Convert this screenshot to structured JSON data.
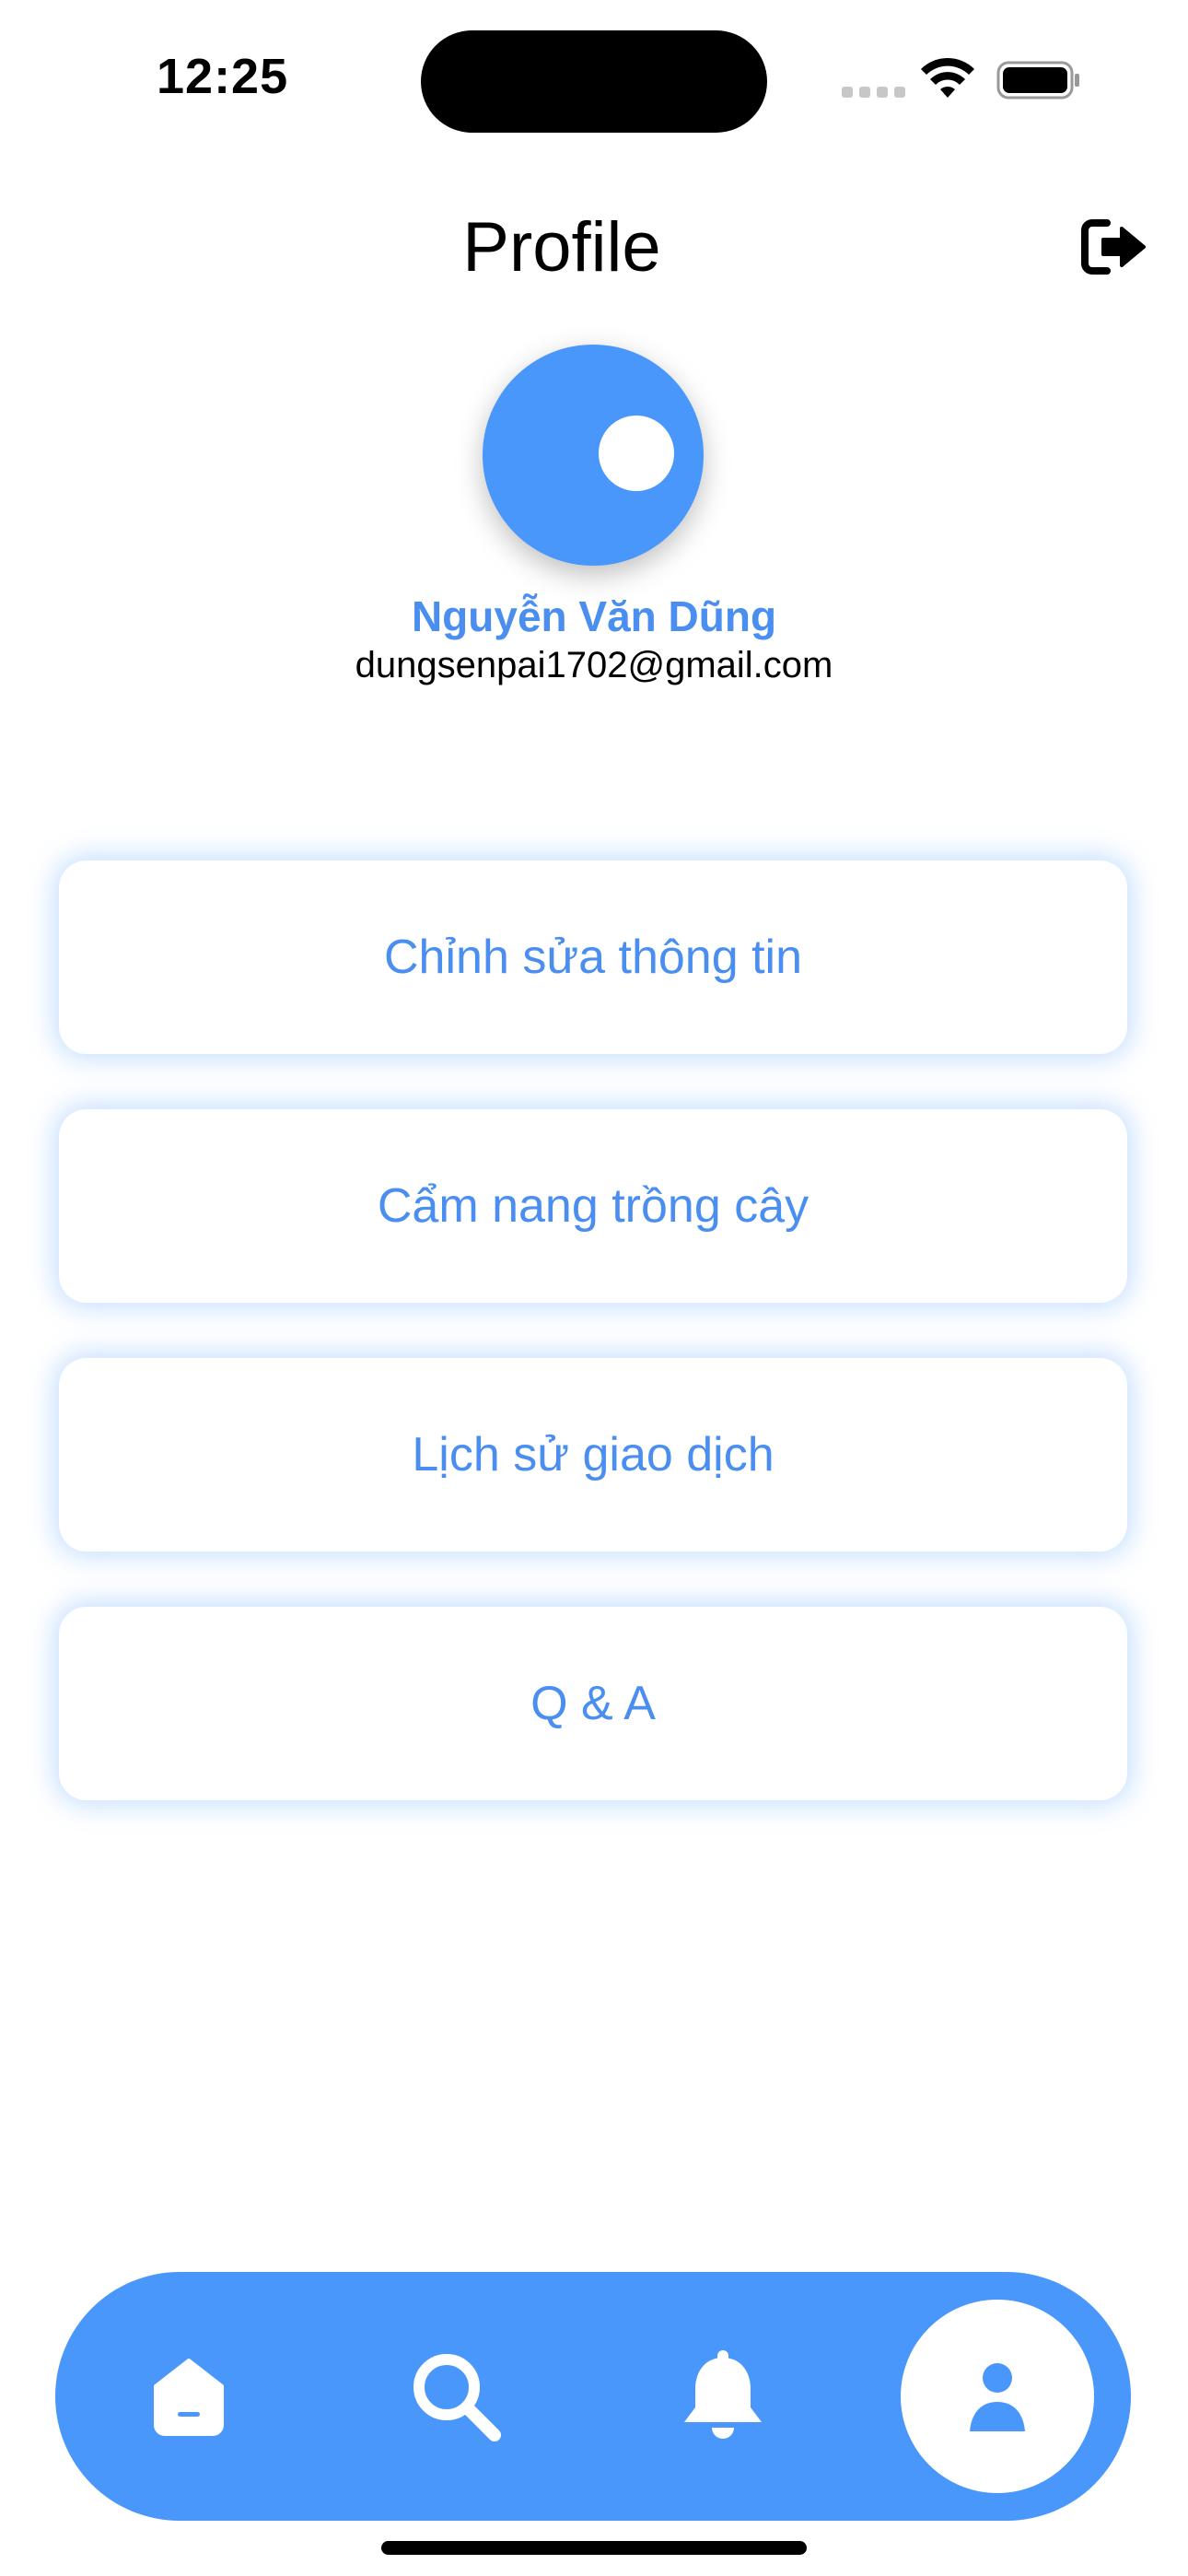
{
  "status_bar": {
    "time": "12:25",
    "icons": [
      "cellular-signal-icon",
      "wifi-icon",
      "battery-icon"
    ]
  },
  "header": {
    "title": "Profile",
    "logout_icon": "logout-icon"
  },
  "profile": {
    "name": "Nguyễn Văn Dũng",
    "email": "dungsenpai1702@gmail.com"
  },
  "menu": {
    "items": [
      {
        "label": "Chỉnh sửa thông tin"
      },
      {
        "label": "Cẩm nang trồng cây"
      },
      {
        "label": "Lịch sử giao dịch"
      },
      {
        "label": "Q & A"
      }
    ]
  },
  "bottom_nav": {
    "items": [
      {
        "icon": "home-icon"
      },
      {
        "icon": "search-icon"
      },
      {
        "icon": "bell-icon"
      },
      {
        "icon": "user-icon",
        "active": true
      }
    ]
  },
  "colors": {
    "accent": "#4a97fb",
    "accent_text": "#4a8ef0",
    "background": "#ffffff"
  }
}
